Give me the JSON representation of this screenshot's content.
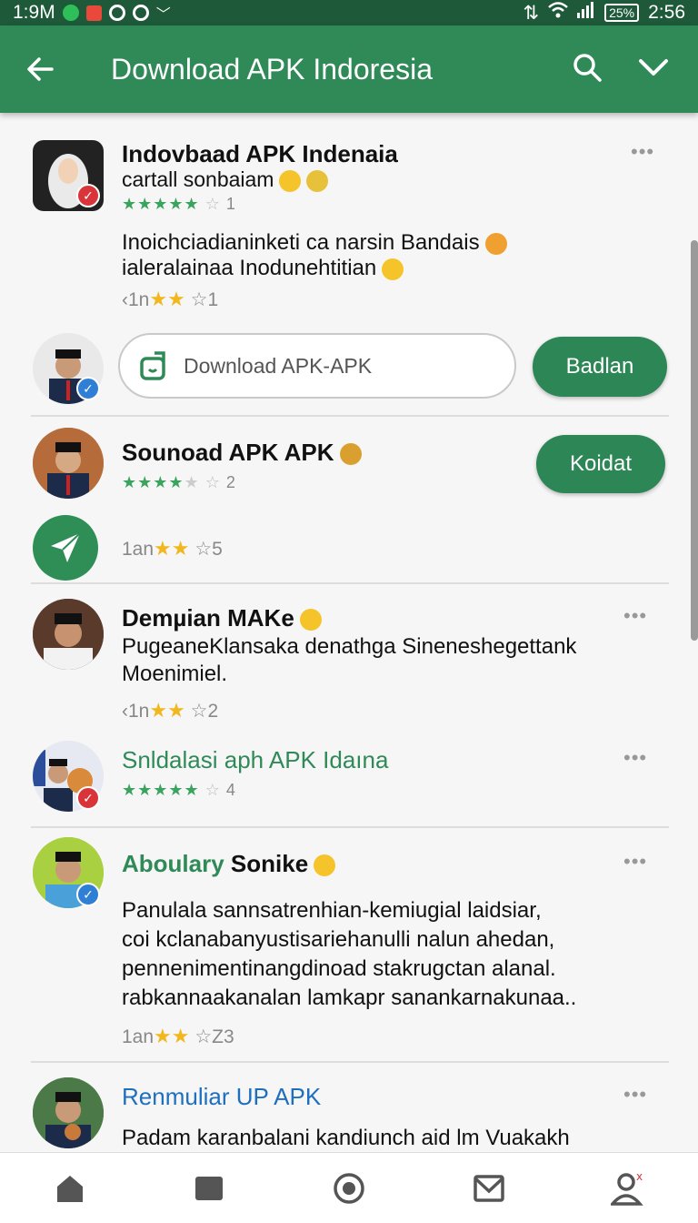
{
  "status": {
    "left_time": "1:9M",
    "battery": "25%",
    "clock": "2:56"
  },
  "appbar": {
    "title": "Download APK Indoresia",
    "icons": [
      "back-arrow-icon",
      "search-icon",
      "chevron-down-icon"
    ]
  },
  "feed": {
    "item1": {
      "name": "Indovbaad APK Indenaia",
      "sub": "cartall sonbaiam",
      "rating_count": "1",
      "body_line1": "Inoichciadianinketi ca narsin Bandais",
      "body_line2": "ialeralainaa Inodunehtitian",
      "meta_prefix": "1n",
      "meta_count": "1"
    },
    "download": {
      "placeholder": "Download APK-APK",
      "button": "Badlan"
    },
    "item2": {
      "name": "Sounoad APK APK",
      "rating_count": "2",
      "button": "Koidat",
      "meta_prefix": "1an",
      "meta_count": "5"
    },
    "item3": {
      "name": "Demµian MAKe",
      "body_line1": "PugeaneKlansaka denathga Sineneshegettank",
      "body_line2": "Moenimiel.",
      "meta_prefix": "1n",
      "meta_count": "2"
    },
    "item4": {
      "name": "Snldalasi aph APK Idaına",
      "rating_count": "4"
    },
    "item5": {
      "name_green": "Aboulary",
      "name_black": "Sonike",
      "body_line1": "Panulala sannsatrenhian-kemiugial  laidsiar,",
      "body_line2": "coi kclanabanyustisariehanulli nalun ahedan,",
      "body_line3": "pennenimentinangdinoad stakrugctan alanal.",
      "body_line4": "rabkannaakanalan lamkapr sanankarnakunaa..",
      "meta_prefix": "1an",
      "meta_count": "Z3"
    },
    "item6": {
      "name": "Renmuliar UP APK",
      "body_line1": "Padam karanbalani kandiunch aid lm Vuakakh"
    }
  },
  "bottom_nav": [
    "home-icon",
    "stop-square-icon",
    "record-circle-icon",
    "mail-icon",
    "profile-icon"
  ],
  "colors": {
    "primary": "#2f8a58",
    "status_bar": "#1e5a3a",
    "star_green": "#3aa35e",
    "star_yellow": "#f1b71f",
    "link_blue": "#1f6fbf"
  }
}
